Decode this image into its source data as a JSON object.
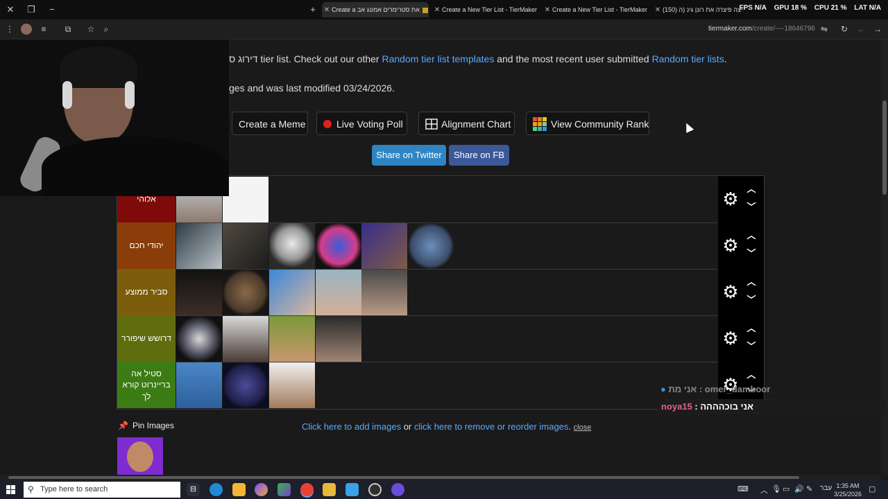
{
  "tabs": [
    {
      "title": "Create a את סטרימרים אמונג אב"
    },
    {
      "title": "Create a New Tier List - TierMaker"
    },
    {
      "title": "Create a New Tier List - TierMaker"
    },
    {
      "title": "(150) פיצה פיצרה את רונן גינ (ה"
    }
  ],
  "hud": {
    "fps_label": "FPS",
    "fps_value": "N/A",
    "gpu_label": "GPU",
    "gpu_value": "18 %",
    "cpu_label": "CPU",
    "cpu_value": "21 %",
    "lat_label": "LAT",
    "lat_value": "N/A"
  },
  "address": {
    "domain": "tiermaker.com",
    "path": "/create/----18646796"
  },
  "intro": {
    "prefix": "דירוג ס tier list. Check out our other ",
    "link1": "Random tier list templates",
    "middle": " and the most recent user submitted ",
    "link2": "Random tier lists",
    "suffix": ".",
    "line2": "ges and was last modified 03/24/2026."
  },
  "buttons": {
    "meme": "Create a Meme",
    "poll": "Live Voting Poll",
    "alignment": "Alignment Chart",
    "community": "View Community Rank"
  },
  "share": {
    "twitter": "Share on Twitter",
    "fb": "Share on FB"
  },
  "tiers": [
    {
      "label": "אלוהי",
      "color": "#7e0a0a"
    },
    {
      "label": "יהודי חכם",
      "color": "#8a3d08"
    },
    {
      "label": "סביר ממוצע",
      "color": "#7b5d0b"
    },
    {
      "label": "דרושש שיפורר",
      "color": "#5f6d0f"
    },
    {
      "label": "סטיל אה בריינרוט קורא לך",
      "color": "#3c7c14"
    }
  ],
  "pin": {
    "label": "Pin Images"
  },
  "bottom_bar": {
    "link1": "Click here to add images",
    "or": " or ",
    "link2": "click here to remove or reorder images",
    "dot": ". ",
    "close": "close"
  },
  "chat": {
    "line1": "אני מת : omer_damboor",
    "nick": "noya15",
    "sep": " : ",
    "msg": "אני בוכהההה"
  },
  "taskbar": {
    "search_placeholder": "Type here to search",
    "lang": "עבר",
    "time": "1:35 AM",
    "date": "3/25/2026"
  },
  "colors": {
    "accent_link": "#5aa9ff",
    "twitter": "#2f84c2",
    "facebook": "#3b5998",
    "chat_nick": "#e85d8c"
  }
}
